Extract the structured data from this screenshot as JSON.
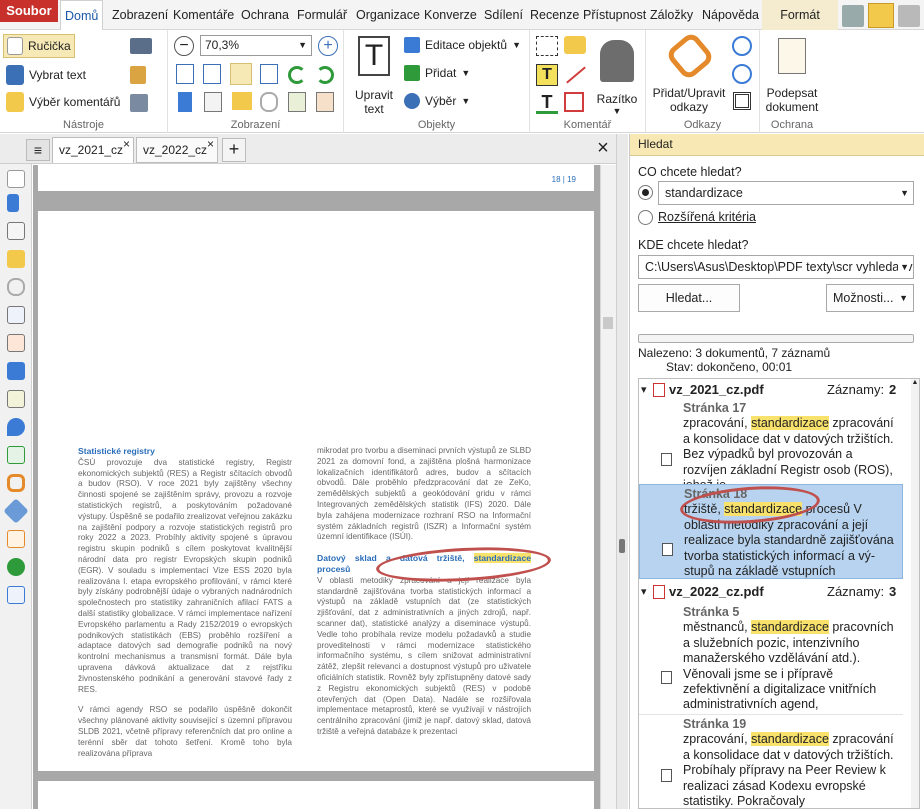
{
  "menu": {
    "tabs": [
      "Soubor",
      "Domů",
      "Zobrazení",
      "Komentáře",
      "Ochrana",
      "Formulář",
      "Organizace",
      "Konverze",
      "Sdílení",
      "Recenze",
      "Přístupnost",
      "Záložky",
      "Nápověda",
      "Formát"
    ]
  },
  "ribbon": {
    "tools": {
      "hand": "Ručička",
      "select_text": "Vybrat text",
      "select_comment": "Výběr komentářů",
      "label": "Nástroje"
    },
    "view": {
      "zoom": "70,3%",
      "label": "Zobrazení"
    },
    "objects": {
      "edit_text": "Upravit text",
      "edit_object": "Editace objektů",
      "add": "Přidat",
      "select": "Výběr",
      "label": "Objekty"
    },
    "comment": {
      "stamp": "Razítko",
      "label": "Komentář"
    },
    "links": {
      "add_edit": "Přidat/Upravit odkazy",
      "label": "Odkazy"
    },
    "protect": {
      "sign": "Podepsat dokument",
      "label": "Ochrana"
    }
  },
  "doc_tabs": [
    "vz_2021_cz",
    "vz_2022_cz"
  ],
  "document": {
    "page_number": "18 | 19",
    "left": {
      "heading": "Statistické registry",
      "para1": "ČSÚ provozuje dva statistické registry, Registr ekonomických subjektů (RES) a Registr sčítacích obvodů a budov (RSO). V roce 2021 byly zajištěny všechny činnosti spojené se zajištěním správy, provozu a rozvoje statistických registrů, a poskytováním požadované výstupy. Úspěšně se podařilo zrealizovat veřejnou zakázku na zajištění podpory a rozvoje statistických registrů pro roky 2022 a 2023. Probíhly aktivity spojené s úpravou registru skupin podniků s cílem poskytovat kvalitnější národní data pro registr Evropských skupin podniků (EGR). V souladu s implementací Vize ESS 2020 byla realizována I. etapa evropského profilování, v rámci které byly získány podrobnější údaje o vybraných nadnárodních společnostech pro statistiky zahraničních afilací FATS a další statistiky globalizace. V rámci implementace nařízení Evropského parlamentu a Rady 2152/2019 o evropských podnikových statistikách (EBS) proběhlo rozšíření a adaptace datových sad demografie podniků na nový kontrolní mechanismus a transmisní formát. Dále byla upravena dávková aktualizace dat z rejstříku živnostenského podnikání a generování stavové řady z RES.",
      "para2": "V rámci agendy RSO se podařilo úspěšně dokončit všechny plánované aktivity související s územní přípravou SLDB 2021, včetně přípravy referenčních dat pro online a terénní sběr dat tohoto šetření. Kromě toho byla realizována příprava"
    },
    "right": {
      "para1": "mikrodat pro tvorbu a diseminaci prvních výstupů ze SLBD 2021 za domovní fond, a zajištěna plošná harmonizace lokalizačních identifikátorů adres, budov a sčítacích obvodů. Dále proběhlo předzpracování dat ze ZeKo, zemědělských subjektů a geokódování gridu v rámci Integrovaných zemědělských statistik (IFS) 2020. Dále byla zahájena modernizace rozhraní RSO na Informační systém základních registrů (ISZR) a Informační systém územní identifikace (ISÚI).",
      "heading_a": "Datový sklad a datová tržiště,",
      "heading_hl": "standardizace",
      "heading_b": "procesů",
      "para2": "V oblasti metodiky zpracování a její realizace byla standardně zajišťována tvorba statistických informací a výstupů na základě vstupních dat (ze statistických zjišťování, dat z administrativních a jiných zdrojů, např. scanner dat), statistické analýzy a diseminace výstupů. Vedle toho probíhala revize modelu požadavků a studie proveditelnosti v rámci modernizace statistického informačního systému, s cílem snižovat administrativní zátěž, zlepšit relevanci a dostupnost výstupů pro uživatele oficiálních statistik. Rovněž byly zpřístupněny datové sady z Registru ekonomických subjektů (RES) v podobě otevřených dat (Open Data). Nadále se rozšiřovala implementace metaprostů, které se využívají v nástrojích centrálního zpracování (jimiž je např. datový sklad, datová tržiště a veřejná databáze k prezentaci"
    }
  },
  "search": {
    "title": "Hledat",
    "what_label": "CO chcete hledat?",
    "what_value": "standardizace",
    "advanced": "Rozšířená kritéria",
    "where_label": "KDE chcete hledat?",
    "where_value": "C:\\Users\\Asus\\Desktop\\PDF texty\\scr vyhledat v",
    "search_button": "Hledat...",
    "options_button": "Možnosti...",
    "found": "Nalezeno: 3 dokumentů, 7 záznamů",
    "status": "Stav: dokončeno, 00:01",
    "results_label": "Záznamy:",
    "files": [
      {
        "name": "vz_2021_cz.pdf",
        "count": "2",
        "hits": [
          {
            "page": "Stránka 17",
            "before": "zpracování,",
            "term": "standardizace",
            "after": "zpracování a konsolidace dat v datových tržištích. Bez výpadků byl provozován a rozvíjen základní Registr osob (ROS), jehož je"
          },
          {
            "page": "Stránka 18",
            "before": "tržiště,",
            "term": "standardizace",
            "after": "procesů V oblasti metodiky zpracování a její realizace byla standardně zajišťována tvorba statistických informací a vý- stupů na základě vstupních"
          }
        ]
      },
      {
        "name": "vz_2022_cz.pdf",
        "count": "3",
        "hits": [
          {
            "page": "Stránka 5",
            "before": "městnanců,",
            "term": "standardizace",
            "after": "pracovních a služebních pozic, intenzivního manažerského vzdělávání atd.). Věnovali jsme se i přípravě zefektivnění a digitalizace vnitřních administrativních agend,"
          },
          {
            "page": "Stránka 19",
            "before": "zpracování,",
            "term": "standardizace",
            "after": "zpracování a konsolidace dat v datových tržištích. Probíhaly přípravy na Peer Review k realizaci zásad Kodexu evropské statistiky. Pokračovaly"
          }
        ]
      }
    ]
  },
  "colors": {
    "accent": "#c8302b",
    "highlight": "#f8e26b",
    "selection": "#b7d3ef",
    "annotation": "#c0504d"
  }
}
